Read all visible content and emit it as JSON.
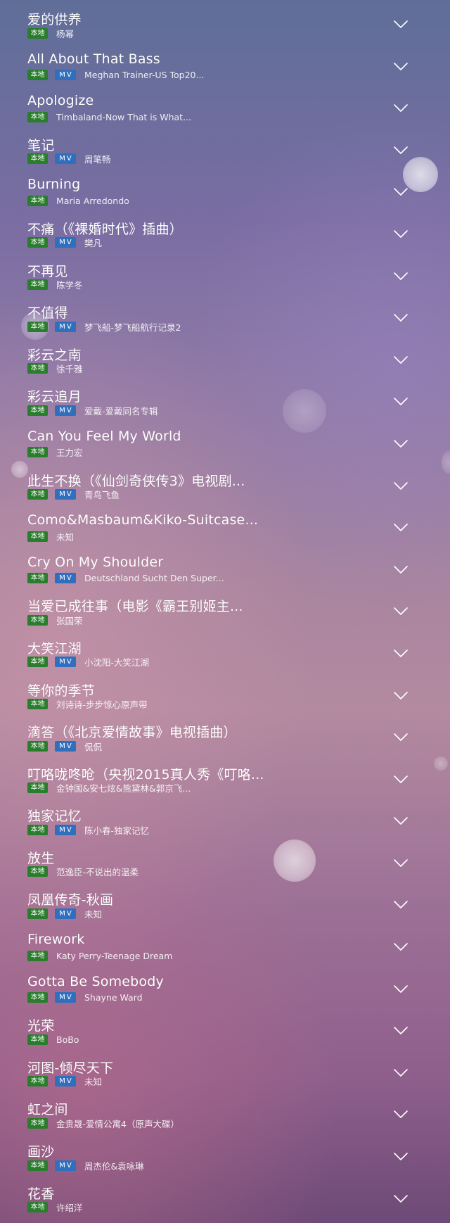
{
  "tags": {
    "local": "本地",
    "mv": "MV"
  },
  "songs": [
    {
      "title": "爱的供养",
      "artist": "杨幂",
      "mv": false
    },
    {
      "title": "All About That Bass",
      "artist": "Meghan Trainer-US Top20...",
      "mv": true
    },
    {
      "title": "Apologize",
      "artist": "Timbaland-Now That is What...",
      "mv": false
    },
    {
      "title": "笔记",
      "artist": "周笔畅",
      "mv": true
    },
    {
      "title": "Burning",
      "artist": "Maria Arredondo",
      "mv": false
    },
    {
      "title": "不痛（《裸婚时代》插曲）",
      "artist": "樊凡",
      "mv": true
    },
    {
      "title": "不再见",
      "artist": "陈学冬",
      "mv": false
    },
    {
      "title": "不值得",
      "artist": "梦飞船-梦飞船航行记录2",
      "mv": true
    },
    {
      "title": "彩云之南",
      "artist": "徐千雅",
      "mv": false
    },
    {
      "title": "彩云追月",
      "artist": "爱戴-爱戴同名专辑",
      "mv": true
    },
    {
      "title": "Can You Feel My World",
      "artist": "王力宏",
      "mv": false
    },
    {
      "title": "此生不换（《仙剑奇侠传3》电视剧...",
      "artist": "青鸟飞鱼",
      "mv": true
    },
    {
      "title": "Como&Masbaum&Kiko-Suitcase...",
      "artist": "未知",
      "mv": false
    },
    {
      "title": "Cry On My Shoulder",
      "artist": "Deutschland Sucht Den Super...",
      "mv": true
    },
    {
      "title": "当爱已成往事（电影《霸王别姬主...",
      "artist": "张国荣",
      "mv": false
    },
    {
      "title": "大笑江湖",
      "artist": "小沈阳-大笑江湖",
      "mv": true
    },
    {
      "title": "等你的季节",
      "artist": "刘诗诗-步步惊心原声带",
      "mv": false
    },
    {
      "title": "滴答（《北京爱情故事》电视插曲）",
      "artist": "侃侃",
      "mv": true
    },
    {
      "title": "叮咯咙咚呛（央视2015真人秀《叮咯...",
      "artist": "金钟国&安七炫&熊黛林&郭京飞...",
      "mv": false
    },
    {
      "title": "独家记忆",
      "artist": "陈小春-独家记忆",
      "mv": true
    },
    {
      "title": "放生",
      "artist": "范逸臣-不说出的温柔",
      "mv": false
    },
    {
      "title": "凤凰传奇-秋画",
      "artist": "未知",
      "mv": true
    },
    {
      "title": "Firework",
      "artist": "Katy Perry-Teenage Dream",
      "mv": false
    },
    {
      "title": "Gotta Be Somebody",
      "artist": "Shayne Ward",
      "mv": true
    },
    {
      "title": "光荣",
      "artist": "BoBo",
      "mv": false
    },
    {
      "title": "河图-倾尽天下",
      "artist": "未知",
      "mv": true
    },
    {
      "title": "虹之间",
      "artist": "金贵晟-爱情公寓4（原声大碟）",
      "mv": false
    },
    {
      "title": "画沙",
      "artist": "周杰伦&袁咏琳",
      "mv": true
    },
    {
      "title": "花香",
      "artist": "许绍洋",
      "mv": false
    }
  ]
}
